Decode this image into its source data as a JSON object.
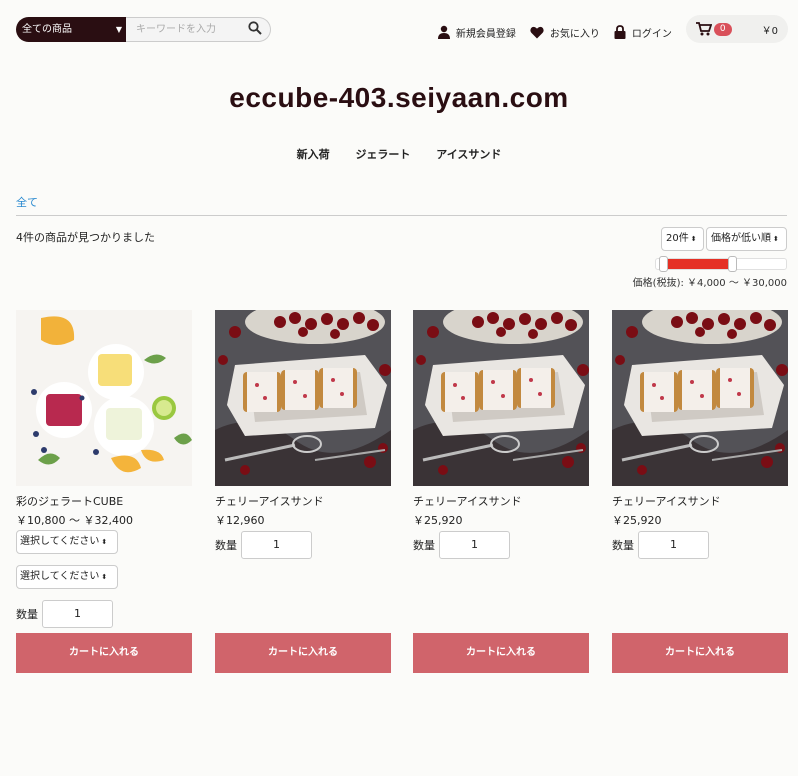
{
  "header": {
    "category_select": "全ての商品",
    "search_placeholder": "キーワードを入力",
    "register_label": "新規会員登録",
    "favorites_label": "お気に入り",
    "login_label": "ログイン",
    "cart_count": "0",
    "cart_total": "￥0"
  },
  "site_title": "eccube-403.seiyaan.com",
  "category_nav": [
    "新入荷",
    "ジェラート",
    "アイスサンド"
  ],
  "breadcrumb": "全て",
  "results": {
    "count_text": "4件の商品が見つかりました",
    "per_page": "20件",
    "sort": "価格が低い順",
    "price_filter": "価格(税抜): ￥4,000 〜 ￥30,000",
    "price_range_min": 4000,
    "price_range_max": 30000
  },
  "products": [
    {
      "name": "彩のジェラートCUBE",
      "price": "￥10,800 ～ ￥32,400",
      "option1": "選択してください",
      "option2": "選択してください",
      "qty_label": "数量",
      "qty": "1",
      "cart_label": "カートに入れる",
      "image": "gelato-cups-image"
    },
    {
      "name": "チェリーアイスサンド",
      "price": "￥12,960",
      "qty_label": "数量",
      "qty": "1",
      "cart_label": "カートに入れる",
      "image": "cherry-ice-sandwich-image"
    },
    {
      "name": "チェリーアイスサンド",
      "price": "￥25,920",
      "qty_label": "数量",
      "qty": "1",
      "cart_label": "カートに入れる",
      "image": "cherry-ice-sandwich-image"
    },
    {
      "name": "チェリーアイスサンド",
      "price": "￥25,920",
      "qty_label": "数量",
      "qty": "1",
      "cart_label": "カートに入れる",
      "image": "cherry-ice-sandwich-image"
    }
  ],
  "colors": {
    "brand_dark": "#2a0e12",
    "cart_button": "#d0646b",
    "slider_range": "#e53025",
    "link": "#2a8ad0"
  }
}
